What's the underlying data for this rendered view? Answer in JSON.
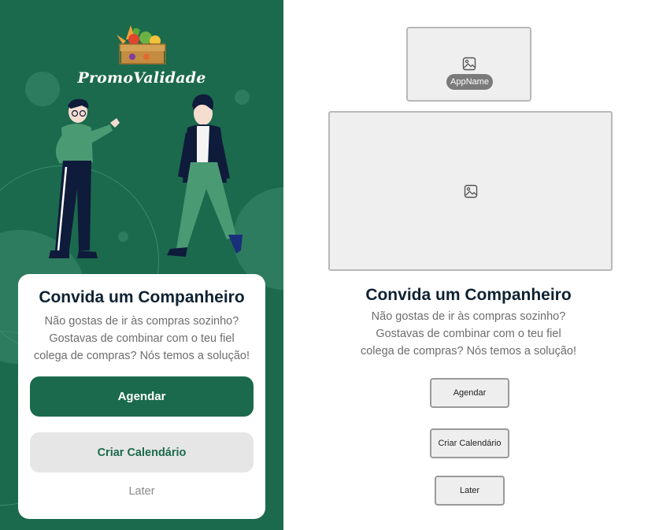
{
  "colors": {
    "brand_green": "#1b6a4d",
    "card_bg": "#ffffff",
    "secondary_button_bg": "#e6e6e6",
    "wireframe_bg": "#efefef"
  },
  "mockup": {
    "brand_name": "PromoValidade",
    "title": "Convida um Companheiro",
    "description_lines": [
      "Não gostas de ir às compras sozinho?",
      "Gostavas de combinar com o teu fiel",
      "colega de compras? Nós temos a solução!"
    ],
    "primary_button": "Agendar",
    "secondary_button": "Criar Calendário",
    "tertiary_button": "Later"
  },
  "wireframe": {
    "logo_placeholder_label": "AppName",
    "title": "Convida um Companheiro",
    "description_lines": [
      "Não gostas de ir às compras sozinho?",
      "Gostavas de combinar com o teu fiel",
      "colega de compras? Nós temos a solução!"
    ],
    "primary_button": "Agendar",
    "secondary_button": "Criar Calendário",
    "tertiary_button": "Later"
  }
}
